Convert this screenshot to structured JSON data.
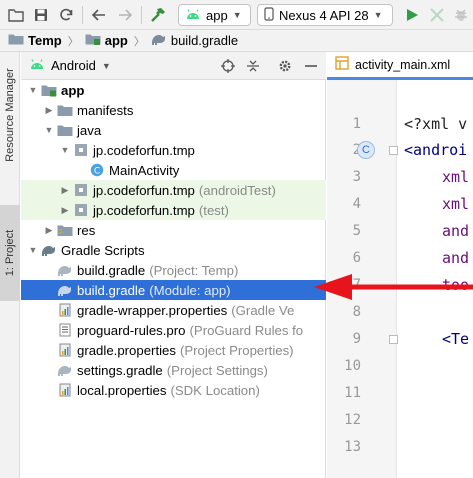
{
  "toolbar": {
    "run_config": "app",
    "device": "Nexus 4 API 28",
    "colors": {
      "android_green": "#3ddc84",
      "run_green": "#2f9e44"
    }
  },
  "breadcrumb": {
    "items": [
      {
        "label": "Temp",
        "icon": "folder-icon"
      },
      {
        "label": "app",
        "icon": "folder-icon"
      },
      {
        "label": "build.gradle",
        "icon": "gradle-icon"
      }
    ]
  },
  "sidebar_tabs": {
    "resource_manager": "Resource Manager",
    "project": "1: Project"
  },
  "project_panel": {
    "view_mode": "Android",
    "tree": [
      {
        "label": "app",
        "hint": "",
        "bold": true
      },
      {
        "label": "manifests",
        "hint": ""
      },
      {
        "label": "java",
        "hint": ""
      },
      {
        "label": "jp.codeforfun.tmp",
        "hint": ""
      },
      {
        "label": "MainActivity",
        "hint": ""
      },
      {
        "label": "jp.codeforfun.tmp",
        "hint": "(androidTest)"
      },
      {
        "label": "jp.codeforfun.tmp",
        "hint": "(test)"
      },
      {
        "label": "res",
        "hint": ""
      },
      {
        "label": "Gradle Scripts",
        "hint": ""
      },
      {
        "label": "build.gradle",
        "hint": "(Project: Temp)"
      },
      {
        "label": "build.gradle",
        "hint": "(Module: app)",
        "selected": true
      },
      {
        "label": "gradle-wrapper.properties",
        "hint": "(Gradle Ve"
      },
      {
        "label": "proguard-rules.pro",
        "hint": "(ProGuard Rules fo"
      },
      {
        "label": "gradle.properties",
        "hint": "(Project Properties)"
      },
      {
        "label": "settings.gradle",
        "hint": "(Project Settings)"
      },
      {
        "label": "local.properties",
        "hint": "(SDK Location)"
      }
    ],
    "colors": {
      "selection": "#2e6fd8",
      "test_tint": "#ecf7e6"
    }
  },
  "editor": {
    "tab_label": "activity_main.xml",
    "line_numbers": [
      "1",
      "2",
      "3",
      "4",
      "5",
      "6",
      "7",
      "8",
      "9",
      "10",
      "11",
      "12",
      "13"
    ],
    "code_lines": [
      "<?xml v",
      "<androi",
      "xml",
      "xml",
      "and",
      "and",
      "too",
      "",
      "<Te"
    ],
    "gutter_badge": "C"
  },
  "annotation": {
    "arrow_color": "#e8141b"
  }
}
